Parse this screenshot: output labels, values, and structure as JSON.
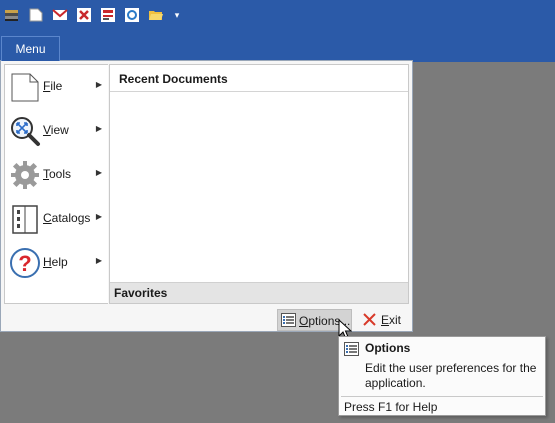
{
  "qat": {
    "icons": [
      "book-icon",
      "new-document-icon",
      "mail-icon",
      "delete-report-icon",
      "report-icon",
      "view-icon",
      "open-folder-icon"
    ],
    "dropdown_glyph": "▾"
  },
  "menu_tab": {
    "label": "Menu"
  },
  "left_items": [
    {
      "label": "File",
      "icon": "file-icon"
    },
    {
      "label": "View",
      "icon": "zoom-view-icon"
    },
    {
      "label": "Tools",
      "icon": "gear-icon"
    },
    {
      "label": "Catalogs",
      "icon": "catalog-icon"
    },
    {
      "label": "Help",
      "icon": "help-icon"
    }
  ],
  "submenu_arrow": "▶",
  "recent": {
    "title": "Recent Documents"
  },
  "favorites": {
    "title": "Favorites"
  },
  "buttons": {
    "options_label": "Options...",
    "exit_label": "Exit"
  },
  "tooltip": {
    "title": "Options",
    "description": "Edit the user preferences for the application.",
    "footer": "Press F1 for Help"
  },
  "colors": {
    "accent": "#2b5aa8",
    "workspace": "#7b7b7b",
    "exit_red": "#d83a2a",
    "help_red": "#d9262c"
  }
}
